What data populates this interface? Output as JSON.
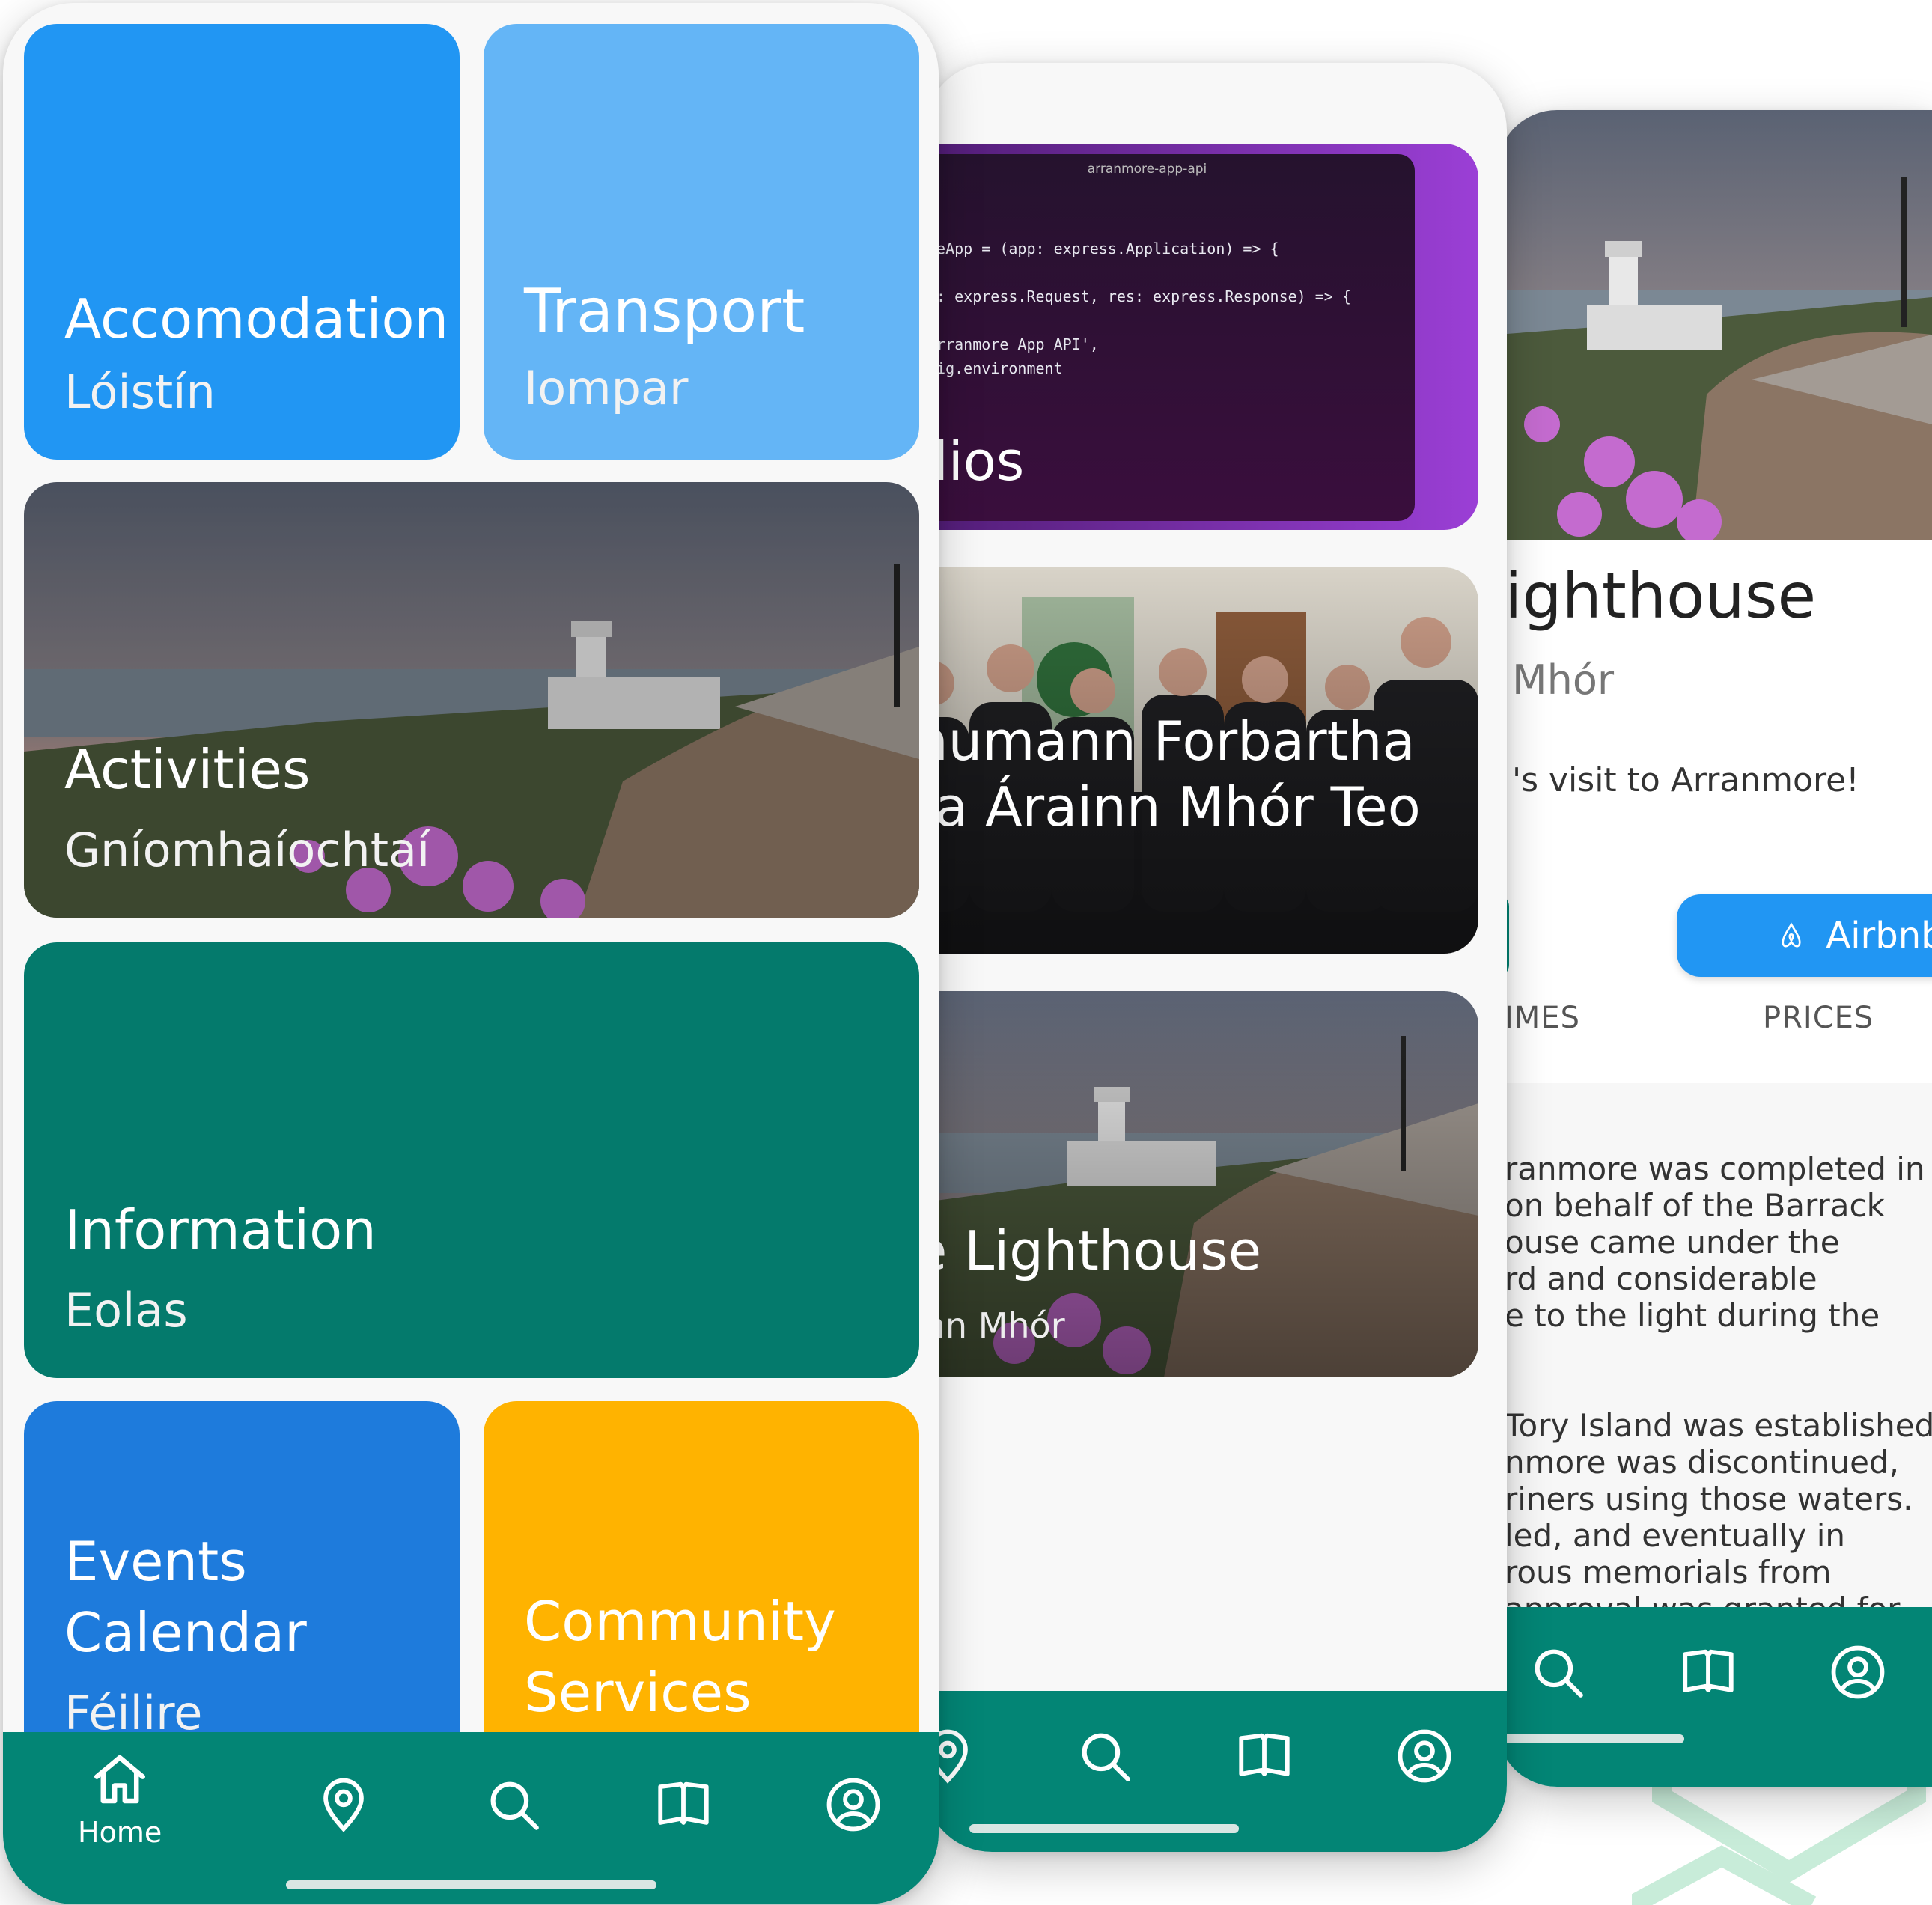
{
  "home": {
    "tiles": [
      {
        "title": "Accomodation",
        "subtitle": "Lóistín"
      },
      {
        "title": "Transport",
        "subtitle": "Iompar"
      },
      {
        "title": "Activities",
        "subtitle": "Gníomhaíochtaí"
      },
      {
        "title": "Information",
        "subtitle": "Eolas"
      },
      {
        "title_line1": "Events",
        "title_line2": "Calendar",
        "subtitle": "Féilire"
      },
      {
        "title_line1": "Community",
        "title_line2": "Services"
      }
    ],
    "nav": {
      "home_label": "Home"
    }
  },
  "list": {
    "cards": [
      {
        "title": "dios",
        "code_window_title": "arranmore-app-api",
        "code_lines": [
          "reApp = (app: express.Application) => {",
          "q: express.Request, res: express.Response) => {",
          "Arranmore App API',",
          "fig.environment"
        ]
      },
      {
        "title_line1": "humann Forbartha",
        "title_line2": "ta Árainn Mhór Teo"
      },
      {
        "title": "e Lighthouse",
        "subtitle": "inn Mhór"
      }
    ]
  },
  "detail": {
    "title": "ighthouse",
    "subtitle": "Mhór",
    "tagline": "'s visit to Arranmore!",
    "airbnb_label": "Airbnb",
    "tabs": [
      "IMES",
      "PRICES"
    ],
    "body_lines": [
      "ranmore was completed in",
      "on behalf of the Barrack",
      "ouse came under the",
      "rd and considerable",
      "e to the light during the",
      "",
      "",
      "Tory Island was established",
      "nmore was discontinued,",
      "riners using those waters.",
      "led, and eventually in",
      "rous memorials from",
      "approval was granted for"
    ]
  },
  "colors": {
    "accommodation": "#2196f3",
    "transport": "#64b5f6",
    "information": "#047a6c",
    "events": "#1e7bdc",
    "community": "#ffb300",
    "navbar": "#038575"
  }
}
